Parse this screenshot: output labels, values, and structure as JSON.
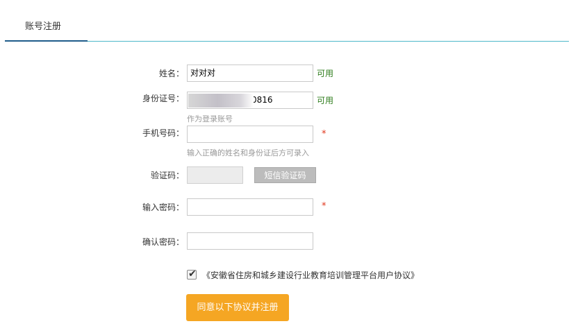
{
  "header": {
    "tab_title": "账号注册"
  },
  "form": {
    "name": {
      "label": "姓名：",
      "value": "对对对",
      "status": "可用"
    },
    "id_number": {
      "label": "身份证号：",
      "value_visible_suffix": "0816",
      "status": "可用",
      "hint": "作为登录账号"
    },
    "phone": {
      "label": "手机号码：",
      "value": "",
      "required_mark": "*",
      "hint": "输入正确的姓名和身份证后方可录入"
    },
    "verify_code": {
      "label": "验证码：",
      "value": "",
      "sms_button": "短信验证码"
    },
    "password": {
      "label": "输入密码：",
      "value": "",
      "required_mark": "*"
    },
    "confirm_password": {
      "label": "确认密码：",
      "value": ""
    },
    "agreement": {
      "checked": true,
      "text": "《安徽省住房和城乡建设行业教育培训管理平台用户协议》"
    },
    "submit_label": "同意以下协议并注册"
  },
  "colors": {
    "accent_dark": "#1f5c8a",
    "accent_light": "#4db7c9",
    "status_ok": "#2f7d1d",
    "required": "#e0351b",
    "submit_bg": "#f5a623"
  }
}
